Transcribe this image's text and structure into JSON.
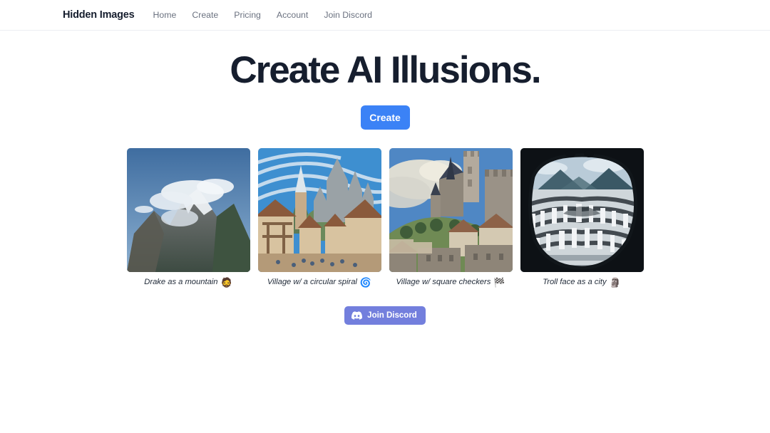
{
  "nav": {
    "brand": "Hidden Images",
    "links": [
      {
        "label": "Home",
        "name": "nav-link-home"
      },
      {
        "label": "Create",
        "name": "nav-link-create"
      },
      {
        "label": "Pricing",
        "name": "nav-link-pricing"
      },
      {
        "label": "Account",
        "name": "nav-link-account"
      },
      {
        "label": "Join Discord",
        "name": "nav-link-join-discord"
      }
    ]
  },
  "hero": {
    "title": "Create AI Illusions.",
    "cta_label": "Create"
  },
  "gallery": {
    "items": [
      {
        "caption": "Drake as a mountain",
        "emoji": "🧔",
        "emoji_name": "bearded-person-emoji",
        "art": "snowy-mountain-with-clouds"
      },
      {
        "caption": "Village w/ a circular spiral",
        "emoji": "🌀",
        "emoji_name": "spiral-emoji",
        "art": "medieval-village-with-castle-spiral-sky"
      },
      {
        "caption": "Village w/ square checkers",
        "emoji": "🏁",
        "emoji_name": "checkered-flag-emoji",
        "art": "hilltop-castle-village"
      },
      {
        "caption": "Troll face as a city",
        "emoji": "🗿",
        "emoji_name": "troll-face-emoji",
        "art": "aerial-city-troll-face"
      }
    ]
  },
  "footer": {
    "discord_label": "Join Discord",
    "discord_icon": "discord-logo-icon"
  },
  "colors": {
    "accent_blue": "#3b82f6",
    "discord_purple": "#737fdd",
    "heading": "#161e2e",
    "nav_link": "#6b7280",
    "border": "#eceef3",
    "page_bg": "#ffffff"
  }
}
